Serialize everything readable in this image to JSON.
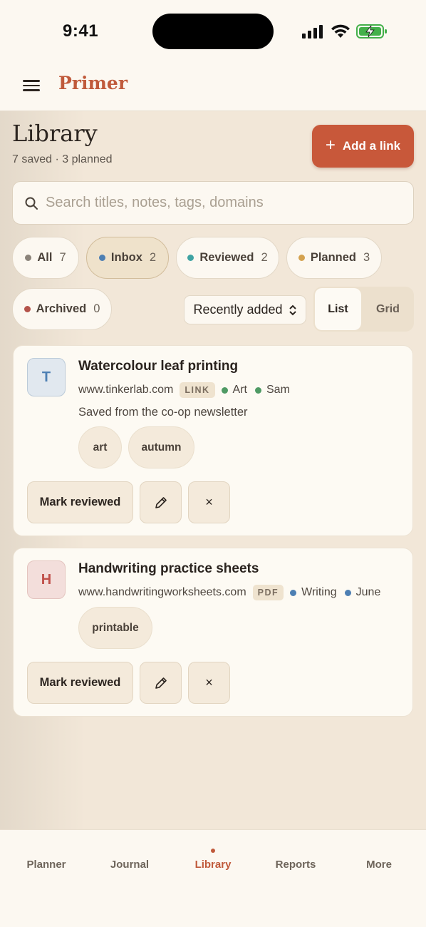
{
  "status_bar": {
    "time": "9:41"
  },
  "app": {
    "brand": "Primer",
    "menu_icon": "menu-icon"
  },
  "header": {
    "title": "Library",
    "subtitle": "7 saved · 3 planned",
    "add_button": "Add a link"
  },
  "search": {
    "placeholder": "Search titles, notes, tags, domains",
    "value": ""
  },
  "filters": [
    {
      "label": "All",
      "count": "7",
      "dot": "#8b837a",
      "active": false
    },
    {
      "label": "Inbox",
      "count": "2",
      "dot": "#4d7fb3",
      "active": true
    },
    {
      "label": "Reviewed",
      "count": "2",
      "dot": "#3fa3a3",
      "active": false
    },
    {
      "label": "Planned",
      "count": "3",
      "dot": "#d4a24f",
      "active": false
    },
    {
      "label": "Archived",
      "count": "0",
      "dot": "#b4534a",
      "active": false
    }
  ],
  "sort": {
    "selected": "Recently added"
  },
  "view_toggle": {
    "list": "List",
    "grid": "Grid",
    "selected": "List"
  },
  "items": [
    {
      "initial": "T",
      "avatar_bg": "#e1e8ef",
      "avatar_fg": "#4d7fb3",
      "title": "Watercolour leaf printing",
      "domain": "www.tinkerlab.com",
      "kind": "LINK",
      "subject": "Art",
      "subject_color": "#4f9a64",
      "person": "Sam",
      "person_color": "#4f9a64",
      "note": "Saved from the co-op newsletter",
      "tags": [
        "art",
        "autumn"
      ],
      "action": "Mark reviewed"
    },
    {
      "initial": "H",
      "avatar_bg": "#f3dedb",
      "avatar_fg": "#c0504a",
      "title": "Handwriting practice sheets",
      "domain": "www.handwritingworksheets.com",
      "kind": "PDF",
      "subject": "Writing",
      "subject_color": "#4d7fb3",
      "person": "June",
      "person_color": "#4d7fb3",
      "note": "",
      "tags": [
        "printable"
      ],
      "action": "Mark reviewed"
    }
  ],
  "nav": {
    "items": [
      "Planner",
      "Journal",
      "Library",
      "Reports",
      "More"
    ],
    "active": "Library"
  },
  "colors": {
    "accent": "#c05a3b",
    "background": "#f2e7d8",
    "card": "#fdfaf3"
  }
}
